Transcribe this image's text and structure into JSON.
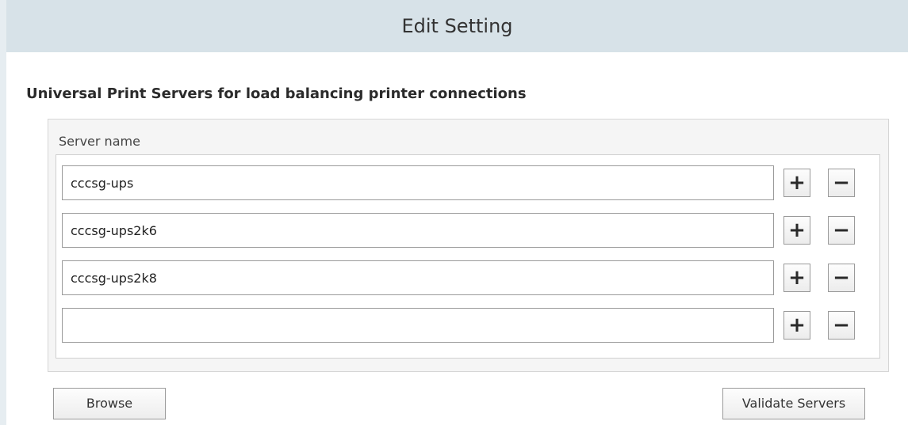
{
  "window": {
    "title": "Edit Setting"
  },
  "section": {
    "heading": "Universal Print Servers for load balancing printer connections"
  },
  "table": {
    "column_header": "Server name",
    "rows": [
      {
        "value": "cccsg-ups",
        "placeholder": ""
      },
      {
        "value": "cccsg-ups2k6",
        "placeholder": ""
      },
      {
        "value": "cccsg-ups2k8",
        "placeholder": ""
      },
      {
        "value": "",
        "placeholder": ""
      }
    ],
    "add_label": "+",
    "remove_label": "−"
  },
  "actions": {
    "browse_label": "Browse",
    "validate_label": "Validate Servers"
  },
  "icons": {
    "add": "plus-icon",
    "remove": "minus-icon"
  },
  "colors": {
    "title_bar": "#d7e2e8",
    "panel": "#f5f5f5"
  }
}
